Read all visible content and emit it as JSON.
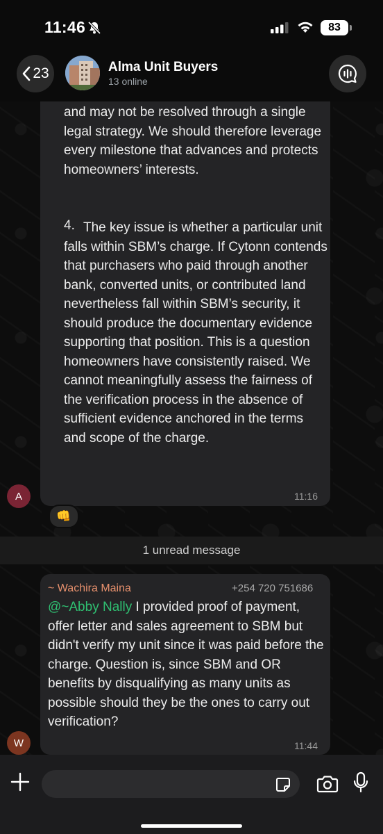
{
  "status_bar": {
    "time": "11:46",
    "battery": "83"
  },
  "header": {
    "back_count": "23",
    "group_name": "Alma Unit Buyers",
    "group_subtitle": "13 online"
  },
  "messages": [
    {
      "avatar_initial": "A",
      "avatar_color": "#7a2434",
      "paragraph_1": "and may not be resolved through a single legal strategy. We should therefore leverage every milestone that advances and protects homeowners’ interests.",
      "list_number": "4.",
      "paragraph_2": "The key issue is whether a particular unit falls within SBM’s charge. If Cytonn contends that purchasers who paid through another bank, converted units, or contributed land nevertheless fall within SBM’s security, it should produce the documentary evidence supporting that position. This is a question homeowners have consistently raised. We cannot meaningfully assess the fairness of the verification process in the absence of sufficient evidence anchored in the terms and scope of the charge.",
      "time": "11:16",
      "reaction": "👊"
    },
    {
      "avatar_initial": "W",
      "avatar_color": "#7c3520",
      "sender_name": "~ Wachira Maina",
      "sender_phone": "+254 720 751686",
      "mention": "@~Abby Nally",
      "text": " I provided proof of payment, offer letter and sales agreement to SBM but didn't verify my unit since it was paid before the charge. Question is, since SBM and OR benefits by disqualifying as many units as possible should they be the ones to carry out verification?",
      "time": "11:44"
    }
  ],
  "unread_divider": "1 unread message",
  "composer": {
    "placeholder": ""
  },
  "icons": [
    "bell-slash-icon",
    "signal-icon",
    "wifi-icon",
    "chevron-left-icon",
    "voice-chat-icon",
    "plus-icon",
    "sticker-icon",
    "camera-icon",
    "microphone-icon"
  ],
  "colors": {
    "bubble": "#242426",
    "sender_name": "#e6906d",
    "mention": "#2fbf71"
  }
}
